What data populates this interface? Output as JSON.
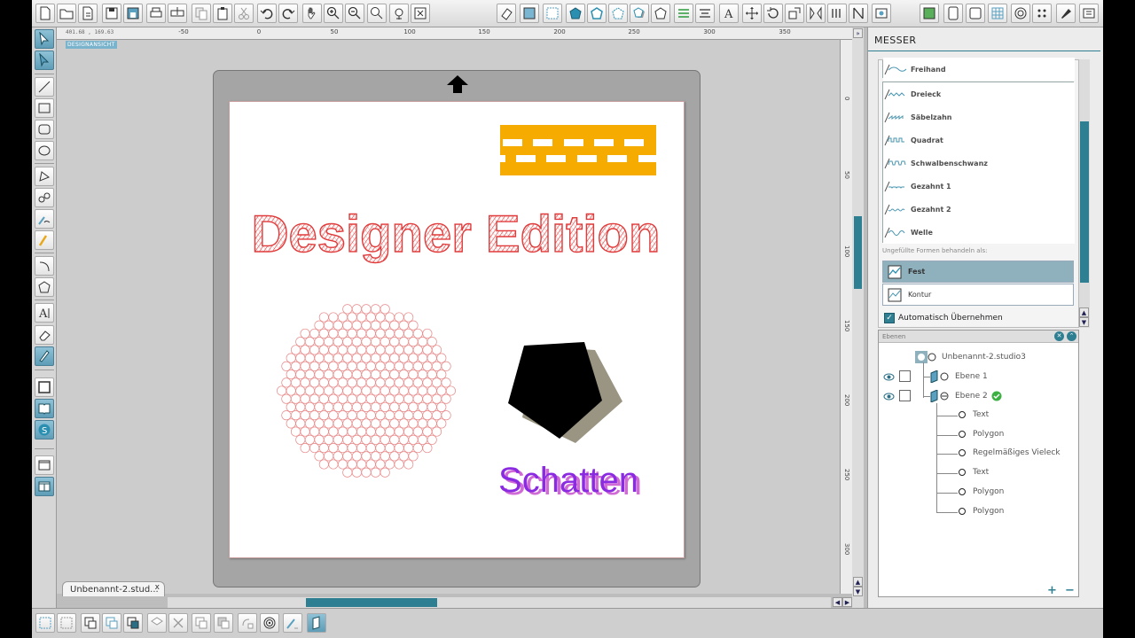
{
  "document": {
    "tab_label": "Unbenannt-2.stud...",
    "tab_close": "x",
    "coordinates": "401.68 , 169.63",
    "view_tag": "DESIGNANSICHT"
  },
  "ruler": {
    "top_labels": [
      "-50",
      "0",
      "50",
      "100",
      "150",
      "200",
      "250",
      "300",
      "350"
    ],
    "right_labels": [
      "0",
      "50",
      "100",
      "150",
      "200",
      "250",
      "300"
    ]
  },
  "canvas": {
    "title_text": "Designer Edition",
    "shadow_text": "Schatten",
    "colors": {
      "title": "#e03a3a",
      "shadow_text": "#8a2be2",
      "shadow_offset": "#d06bd6",
      "ribbon": "#f5ab00",
      "pentagon": "#000000",
      "pentagon_shadow": "#9a9482",
      "circles": "#e88a8a"
    }
  },
  "right_panel": {
    "title": "MESSER",
    "knife_styles": [
      {
        "label": "Freihand",
        "icon": "freehand-line-icon"
      },
      {
        "label": "Dreieck",
        "icon": "triangle-wave-icon"
      },
      {
        "label": "Säbelzahn",
        "icon": "sawtooth-wave-icon"
      },
      {
        "label": "Quadrat",
        "icon": "square-wave-icon"
      },
      {
        "label": "Schwalbenschwanz",
        "icon": "dovetail-wave-icon"
      },
      {
        "label": "Gezahnt 1",
        "icon": "serrated-1-icon"
      },
      {
        "label": "Gezahnt 2",
        "icon": "serrated-2-icon"
      },
      {
        "label": "Welle",
        "icon": "wave-icon"
      }
    ],
    "unfilled_label": "Ungefüllte Formen behandeln als:",
    "fill_options": [
      {
        "label": "Fest",
        "selected": true
      },
      {
        "label": "Kontur",
        "selected": false
      }
    ],
    "auto_apply": {
      "label": "Automatisch Übernehmen",
      "checked": true
    }
  },
  "layers": {
    "header": "Ebenen",
    "document_name": "Unbenannt-2.studio3",
    "layer_list": [
      {
        "label": "Ebene 1",
        "active": false
      },
      {
        "label": "Ebene 2",
        "active": true
      }
    ],
    "objects": [
      "Text",
      "Polygon",
      "Regelmäßiges Vieleck",
      "Text",
      "Polygon",
      "Polygon"
    ],
    "add_symbol": "+",
    "remove_symbol": "−"
  }
}
